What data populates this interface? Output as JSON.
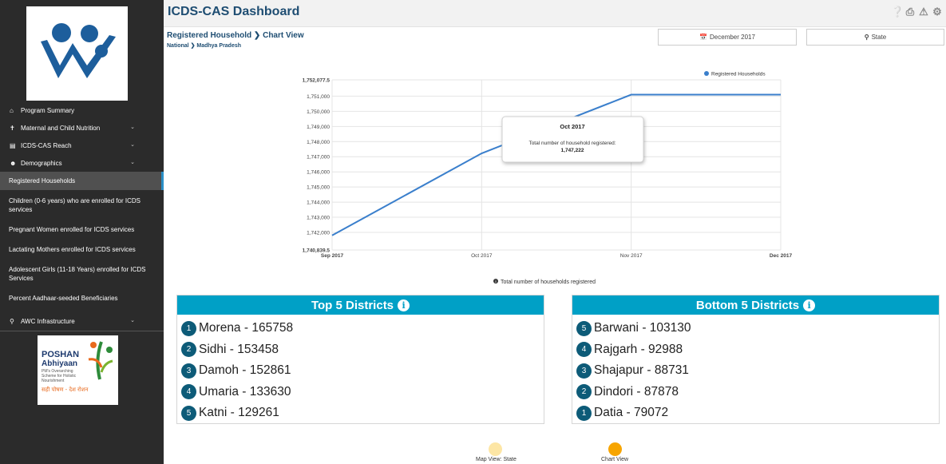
{
  "header": {
    "title": "ICDS-CAS Dashboard"
  },
  "breadcrumb": {
    "title": "Registered Household",
    "view": "Chart View",
    "path_root": "National",
    "path_leaf": "Madhya Pradesh"
  },
  "filters": {
    "month": "December 2017",
    "level": "State"
  },
  "sidebar": {
    "items": [
      {
        "label": "Program Summary",
        "icon": "home-icon"
      },
      {
        "label": "Maternal and Child Nutrition",
        "icon": "child-icon"
      },
      {
        "label": "ICDS-CAS Reach",
        "icon": "bar-chart-icon"
      },
      {
        "label": "Demographics",
        "icon": "users-icon"
      }
    ],
    "sub_items": [
      "Registered Households",
      "Children (0-6 years) who are enrolled for ICDS services",
      "Pregnant Women enrolled for ICDS services",
      "Lactating Mothers enrolled for ICDS services",
      "Adolescent Girls (11-18 Years) enrolled for ICDS Services",
      "Percent Aadhaar-seeded Beneficiaries"
    ],
    "awc": "AWC Infrastructure",
    "poshan": {
      "title1": "POSHAN",
      "title2": "Abhiyaan",
      "tag1": "PM's Overarching",
      "tag2": "Scheme for Holistic",
      "tag3": "Nourishment",
      "hindi": "सही पोषण - देश रोशन"
    }
  },
  "chart_data": {
    "type": "line",
    "categories": [
      "Sep 2017",
      "Oct 2017",
      "Nov 2017",
      "Dec 2017"
    ],
    "series": [
      {
        "name": "Registered Households",
        "values": [
          1741800,
          1747222,
          1751100,
          1751100
        ],
        "color": "#3a7fcc"
      }
    ],
    "ylim": [
      1740839.5,
      1752077.5
    ],
    "yticks": [
      "1,740,839.5",
      "1,742,000",
      "1,743,000",
      "1,744,000",
      "1,745,000",
      "1,746,000",
      "1,747,000",
      "1,748,000",
      "1,749,000",
      "1,750,000",
      "1,751,000",
      "1,752,077.5"
    ],
    "tooltip": {
      "title": "Oct 2017",
      "text": "Total number of household registered:",
      "value": "1,747,222"
    },
    "caption": "Total number of households registered",
    "grid": true,
    "legend": "top-right"
  },
  "top": {
    "title": "Top 5 Districts",
    "rows": [
      {
        "rank": "1",
        "name": "Morena",
        "value": "- 165758"
      },
      {
        "rank": "2",
        "name": "Sidhi",
        "value": "- 153458"
      },
      {
        "rank": "3",
        "name": "Damoh",
        "value": "- 152861"
      },
      {
        "rank": "4",
        "name": "Umaria",
        "value": "- 133630"
      },
      {
        "rank": "5",
        "name": "Katni",
        "value": "- 129261"
      }
    ]
  },
  "bottom": {
    "title": "Bottom 5 Districts",
    "rows": [
      {
        "rank": "5",
        "name": "Barwani",
        "value": "- 103130"
      },
      {
        "rank": "4",
        "name": "Rajgarh",
        "value": "- 92988"
      },
      {
        "rank": "3",
        "name": "Shajapur",
        "value": "- 88731"
      },
      {
        "rank": "2",
        "name": "Dindori",
        "value": "- 87878"
      },
      {
        "rank": "1",
        "name": "Datia",
        "value": "- 79072"
      }
    ]
  },
  "views": {
    "map_label": "Map View: State",
    "chart_label": "Chart View",
    "map_color": "#fde6a5",
    "chart_color": "#f7a500"
  }
}
